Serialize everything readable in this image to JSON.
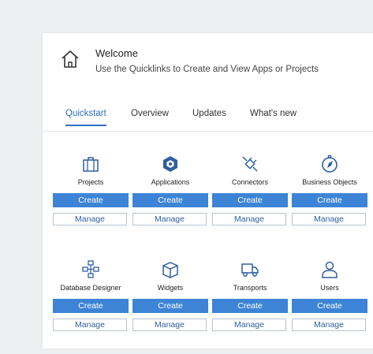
{
  "welcome": {
    "title": "Welcome",
    "subtitle": "Use the Quicklinks to Create and View Apps or Projects",
    "icon": "home-icon"
  },
  "tabs": [
    {
      "label": "Quickstart",
      "active": true
    },
    {
      "label": "Overview",
      "active": false
    },
    {
      "label": "Updates",
      "active": false
    },
    {
      "label": "What's new",
      "active": false
    }
  ],
  "tiles": [
    {
      "label": "Projects",
      "icon": "briefcase-icon",
      "create": "Create",
      "manage": "Manage"
    },
    {
      "label": "Applications",
      "icon": "cube-app-icon",
      "create": "Create",
      "manage": "Manage"
    },
    {
      "label": "Connectors",
      "icon": "plug-icon",
      "create": "Create",
      "manage": "Manage"
    },
    {
      "label": "Business Objects",
      "icon": "compass-icon",
      "create": "Create",
      "manage": "Manage"
    },
    {
      "label": "Database Designer",
      "icon": "database-schema-icon",
      "create": "Create",
      "manage": "Manage"
    },
    {
      "label": "Widgets",
      "icon": "box-icon",
      "create": "Create",
      "manage": "Manage"
    },
    {
      "label": "Transports",
      "icon": "truck-icon",
      "create": "Create",
      "manage": "Manage"
    },
    {
      "label": "Users",
      "icon": "user-icon",
      "create": "Create",
      "manage": "Manage"
    }
  ],
  "colors": {
    "accent": "#3d84d6",
    "tab_active": "#2f6fbf",
    "background": "#eeeff1"
  }
}
